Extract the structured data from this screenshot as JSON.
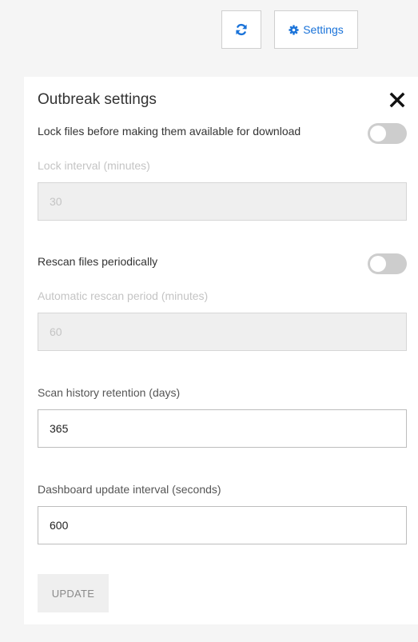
{
  "toolbar": {
    "refresh_icon": "sync-icon",
    "settings_label": "Settings",
    "settings_icon": "gear-icon",
    "accent_color": "#1a73d9"
  },
  "panel": {
    "title": "Outbreak settings",
    "close_icon": "close-icon",
    "lock_files": {
      "label": "Lock files before making them available for download",
      "enabled": false
    },
    "lock_interval": {
      "label": "Lock interval (minutes)",
      "value": "30",
      "disabled": true
    },
    "rescan": {
      "label": "Rescan files periodically",
      "enabled": false
    },
    "rescan_period": {
      "label": "Automatic rescan period (minutes)",
      "value": "60",
      "disabled": true
    },
    "scan_history": {
      "label": "Scan history retention (days)",
      "value": "365"
    },
    "dashboard_update": {
      "label": "Dashboard update interval (seconds)",
      "value": "600"
    },
    "update_button": "UPDATE"
  }
}
